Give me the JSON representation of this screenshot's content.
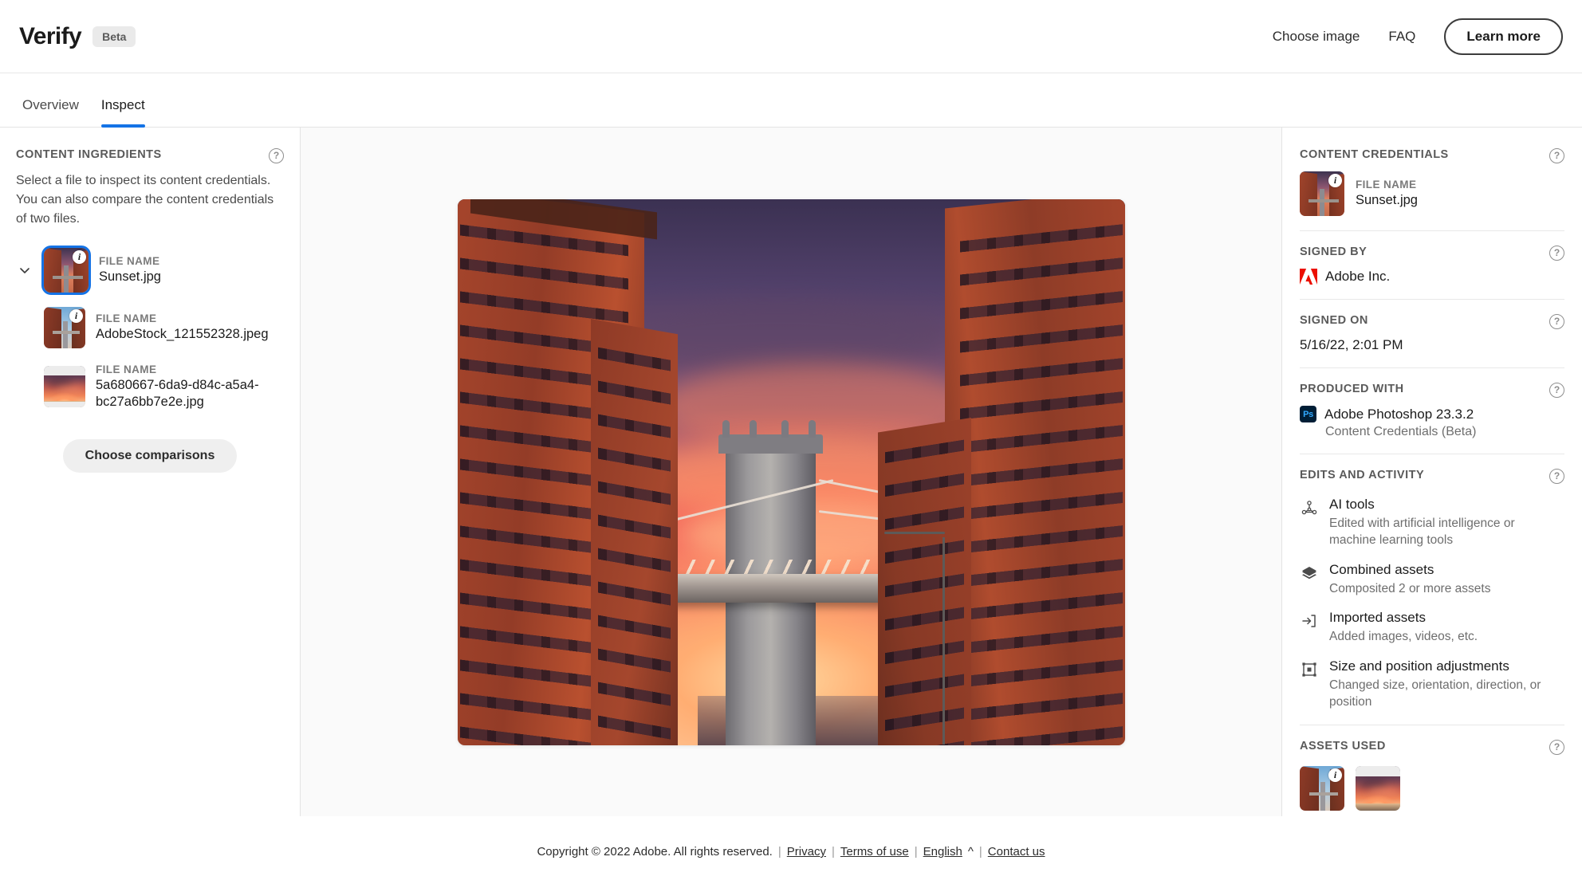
{
  "header": {
    "brand": "Verify",
    "badge": "Beta",
    "links": [
      {
        "label": "Choose image",
        "name": "choose-image-link"
      },
      {
        "label": "FAQ",
        "name": "faq-link"
      }
    ],
    "cta": "Learn more"
  },
  "tabs": [
    {
      "label": "Overview",
      "active": false
    },
    {
      "label": "Inspect",
      "active": true
    }
  ],
  "sidebar": {
    "title": "CONTENT INGREDIENTS",
    "description": "Select a file to inspect its content credentials. You can also compare the content credentials of two files.",
    "file_label": "FILE NAME",
    "files": [
      {
        "name": "Sunset.jpg",
        "selected": true,
        "has_info_badge": true,
        "depth": 0
      },
      {
        "name": "AdobeStock_121552328.jpeg",
        "selected": false,
        "has_info_badge": true,
        "depth": 1
      },
      {
        "name": "5a680667-6da9-d84c-a5a4-bc27a6bb7e2e.jpg",
        "selected": false,
        "has_info_badge": false,
        "depth": 1
      }
    ],
    "choose_comparisons": "Choose comparisons"
  },
  "viewer": {
    "image_alt": "Manhattan Bridge seen between red brick buildings at sunset"
  },
  "credentials": {
    "title": "CONTENT CREDENTIALS",
    "file_label": "FILE NAME",
    "file_name": "Sunset.jpg",
    "signed_by_title": "SIGNED BY",
    "signed_by": "Adobe Inc.",
    "signed_on_title": "SIGNED ON",
    "signed_on": "5/16/22, 2:01 PM",
    "produced_with_title": "PRODUCED WITH",
    "produced_with": "Adobe Photoshop 23.3.2",
    "produced_with_sub": "Content Credentials (Beta)",
    "edits_title": "EDITS AND ACTIVITY",
    "edits": [
      {
        "title": "AI tools",
        "desc": "Edited with artificial intelligence or machine learning tools",
        "icon": "ai-tools-icon"
      },
      {
        "title": "Combined assets",
        "desc": "Composited 2 or more assets",
        "icon": "layers-icon"
      },
      {
        "title": "Imported assets",
        "desc": "Added images, videos, etc.",
        "icon": "import-icon"
      },
      {
        "title": "Size and position adjustments",
        "desc": "Changed size, orientation, direction, or position",
        "icon": "transform-icon"
      }
    ],
    "assets_title": "ASSETS USED"
  },
  "footer": {
    "copyright": "Copyright © 2022 Adobe. All rights reserved.",
    "privacy": "Privacy",
    "terms": "Terms of use",
    "language": "English",
    "language_caret": "^",
    "contact": "Contact us"
  },
  "icons": {
    "help": "?",
    "info": "i"
  },
  "colors": {
    "accent": "#1473e6",
    "adobe_red": "#eb1000",
    "photoshop": "#001e36",
    "photoshop_text": "#31a8ff"
  }
}
